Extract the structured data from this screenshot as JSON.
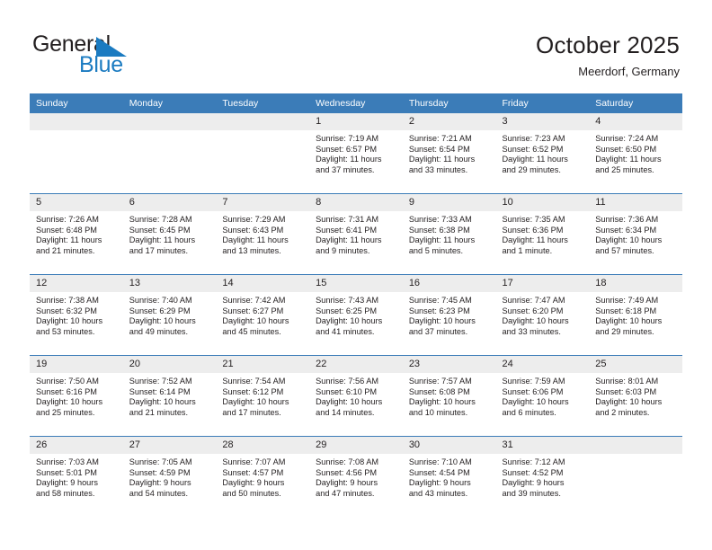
{
  "logo": {
    "word_primary": "General",
    "word_secondary": "Blue",
    "flag_icon": "blue-triangle-flag-icon",
    "primary_color": "#231f20",
    "secondary_color": "#1b7bc1"
  },
  "header": {
    "title": "October 2025",
    "subtitle": "Meerdorf, Germany"
  },
  "theme": {
    "header_band": "#3b7cb8",
    "daynum_band": "#ededed",
    "text": "#231f20",
    "cell_background": "#ffffff"
  },
  "weekdays": [
    "Sunday",
    "Monday",
    "Tuesday",
    "Wednesday",
    "Thursday",
    "Friday",
    "Saturday"
  ],
  "weeks": [
    [
      {
        "day": "",
        "lines": []
      },
      {
        "day": "",
        "lines": []
      },
      {
        "day": "",
        "lines": []
      },
      {
        "day": "1",
        "lines": [
          "Sunrise: 7:19 AM",
          "Sunset: 6:57 PM",
          "Daylight: 11 hours",
          "and 37 minutes."
        ]
      },
      {
        "day": "2",
        "lines": [
          "Sunrise: 7:21 AM",
          "Sunset: 6:54 PM",
          "Daylight: 11 hours",
          "and 33 minutes."
        ]
      },
      {
        "day": "3",
        "lines": [
          "Sunrise: 7:23 AM",
          "Sunset: 6:52 PM",
          "Daylight: 11 hours",
          "and 29 minutes."
        ]
      },
      {
        "day": "4",
        "lines": [
          "Sunrise: 7:24 AM",
          "Sunset: 6:50 PM",
          "Daylight: 11 hours",
          "and 25 minutes."
        ]
      }
    ],
    [
      {
        "day": "5",
        "lines": [
          "Sunrise: 7:26 AM",
          "Sunset: 6:48 PM",
          "Daylight: 11 hours",
          "and 21 minutes."
        ]
      },
      {
        "day": "6",
        "lines": [
          "Sunrise: 7:28 AM",
          "Sunset: 6:45 PM",
          "Daylight: 11 hours",
          "and 17 minutes."
        ]
      },
      {
        "day": "7",
        "lines": [
          "Sunrise: 7:29 AM",
          "Sunset: 6:43 PM",
          "Daylight: 11 hours",
          "and 13 minutes."
        ]
      },
      {
        "day": "8",
        "lines": [
          "Sunrise: 7:31 AM",
          "Sunset: 6:41 PM",
          "Daylight: 11 hours",
          "and 9 minutes."
        ]
      },
      {
        "day": "9",
        "lines": [
          "Sunrise: 7:33 AM",
          "Sunset: 6:38 PM",
          "Daylight: 11 hours",
          "and 5 minutes."
        ]
      },
      {
        "day": "10",
        "lines": [
          "Sunrise: 7:35 AM",
          "Sunset: 6:36 PM",
          "Daylight: 11 hours",
          "and 1 minute."
        ]
      },
      {
        "day": "11",
        "lines": [
          "Sunrise: 7:36 AM",
          "Sunset: 6:34 PM",
          "Daylight: 10 hours",
          "and 57 minutes."
        ]
      }
    ],
    [
      {
        "day": "12",
        "lines": [
          "Sunrise: 7:38 AM",
          "Sunset: 6:32 PM",
          "Daylight: 10 hours",
          "and 53 minutes."
        ]
      },
      {
        "day": "13",
        "lines": [
          "Sunrise: 7:40 AM",
          "Sunset: 6:29 PM",
          "Daylight: 10 hours",
          "and 49 minutes."
        ]
      },
      {
        "day": "14",
        "lines": [
          "Sunrise: 7:42 AM",
          "Sunset: 6:27 PM",
          "Daylight: 10 hours",
          "and 45 minutes."
        ]
      },
      {
        "day": "15",
        "lines": [
          "Sunrise: 7:43 AM",
          "Sunset: 6:25 PM",
          "Daylight: 10 hours",
          "and 41 minutes."
        ]
      },
      {
        "day": "16",
        "lines": [
          "Sunrise: 7:45 AM",
          "Sunset: 6:23 PM",
          "Daylight: 10 hours",
          "and 37 minutes."
        ]
      },
      {
        "day": "17",
        "lines": [
          "Sunrise: 7:47 AM",
          "Sunset: 6:20 PM",
          "Daylight: 10 hours",
          "and 33 minutes."
        ]
      },
      {
        "day": "18",
        "lines": [
          "Sunrise: 7:49 AM",
          "Sunset: 6:18 PM",
          "Daylight: 10 hours",
          "and 29 minutes."
        ]
      }
    ],
    [
      {
        "day": "19",
        "lines": [
          "Sunrise: 7:50 AM",
          "Sunset: 6:16 PM",
          "Daylight: 10 hours",
          "and 25 minutes."
        ]
      },
      {
        "day": "20",
        "lines": [
          "Sunrise: 7:52 AM",
          "Sunset: 6:14 PM",
          "Daylight: 10 hours",
          "and 21 minutes."
        ]
      },
      {
        "day": "21",
        "lines": [
          "Sunrise: 7:54 AM",
          "Sunset: 6:12 PM",
          "Daylight: 10 hours",
          "and 17 minutes."
        ]
      },
      {
        "day": "22",
        "lines": [
          "Sunrise: 7:56 AM",
          "Sunset: 6:10 PM",
          "Daylight: 10 hours",
          "and 14 minutes."
        ]
      },
      {
        "day": "23",
        "lines": [
          "Sunrise: 7:57 AM",
          "Sunset: 6:08 PM",
          "Daylight: 10 hours",
          "and 10 minutes."
        ]
      },
      {
        "day": "24",
        "lines": [
          "Sunrise: 7:59 AM",
          "Sunset: 6:06 PM",
          "Daylight: 10 hours",
          "and 6 minutes."
        ]
      },
      {
        "day": "25",
        "lines": [
          "Sunrise: 8:01 AM",
          "Sunset: 6:03 PM",
          "Daylight: 10 hours",
          "and 2 minutes."
        ]
      }
    ],
    [
      {
        "day": "26",
        "lines": [
          "Sunrise: 7:03 AM",
          "Sunset: 5:01 PM",
          "Daylight: 9 hours",
          "and 58 minutes."
        ]
      },
      {
        "day": "27",
        "lines": [
          "Sunrise: 7:05 AM",
          "Sunset: 4:59 PM",
          "Daylight: 9 hours",
          "and 54 minutes."
        ]
      },
      {
        "day": "28",
        "lines": [
          "Sunrise: 7:07 AM",
          "Sunset: 4:57 PM",
          "Daylight: 9 hours",
          "and 50 minutes."
        ]
      },
      {
        "day": "29",
        "lines": [
          "Sunrise: 7:08 AM",
          "Sunset: 4:56 PM",
          "Daylight: 9 hours",
          "and 47 minutes."
        ]
      },
      {
        "day": "30",
        "lines": [
          "Sunrise: 7:10 AM",
          "Sunset: 4:54 PM",
          "Daylight: 9 hours",
          "and 43 minutes."
        ]
      },
      {
        "day": "31",
        "lines": [
          "Sunrise: 7:12 AM",
          "Sunset: 4:52 PM",
          "Daylight: 9 hours",
          "and 39 minutes."
        ]
      },
      {
        "day": "",
        "lines": []
      }
    ]
  ]
}
